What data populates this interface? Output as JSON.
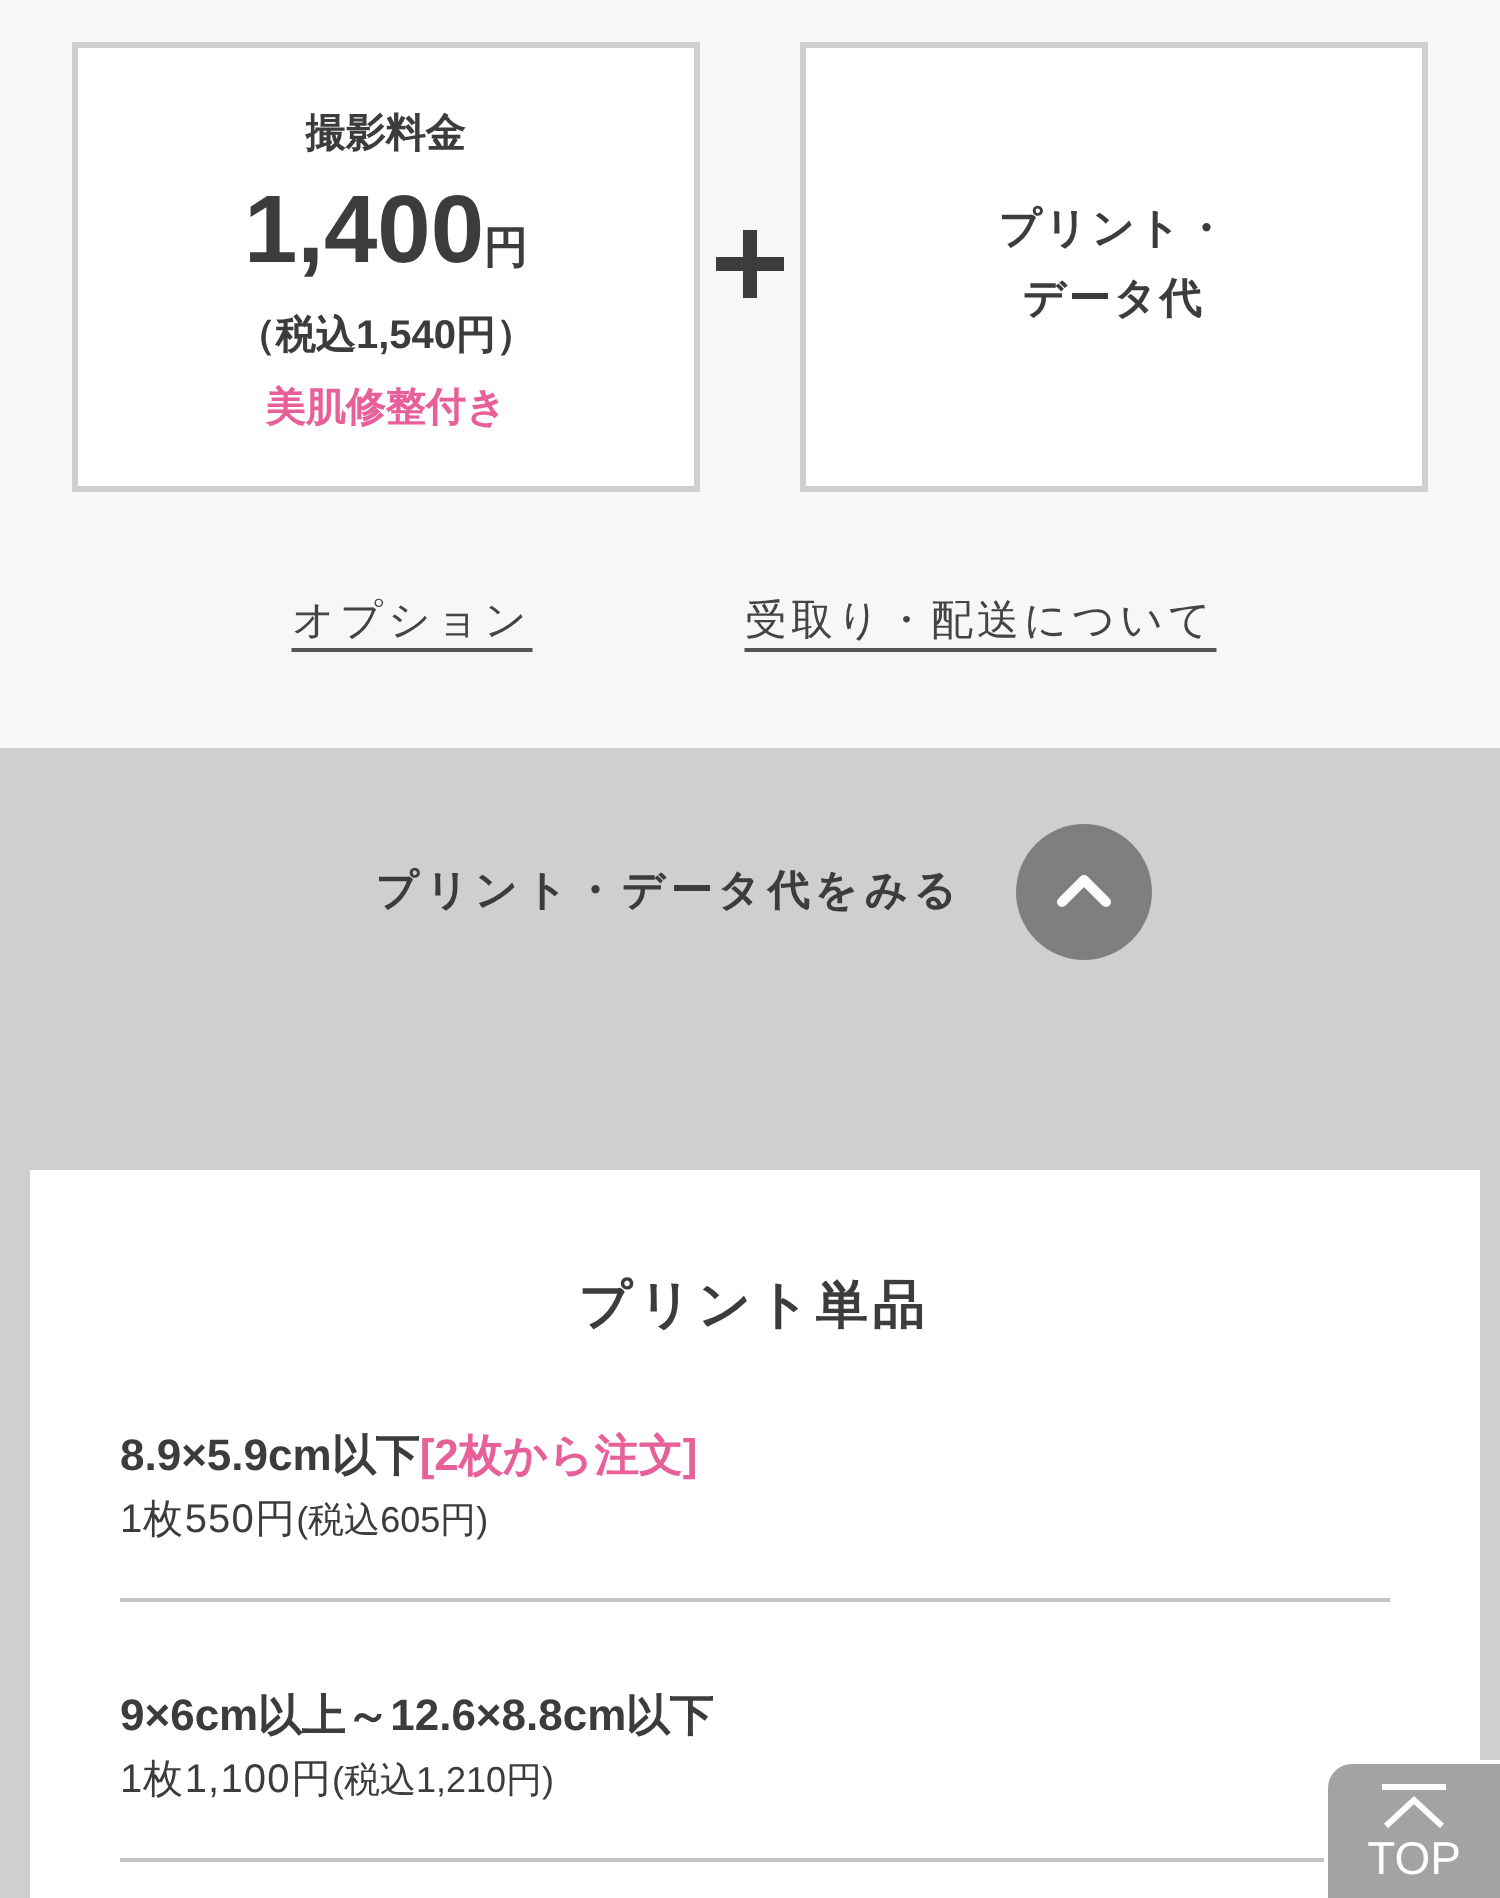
{
  "fee_cards": [
    {
      "kind": "shooting",
      "title": "撮影料金",
      "amount": "1,400",
      "unit": "円",
      "tax_note": "（税込1,540円）",
      "note": "美肌修整付き"
    },
    {
      "kind": "print",
      "title_lines": [
        "プリント・",
        "データ代"
      ]
    }
  ],
  "links": [
    "オプション",
    "受取り・配送について"
  ],
  "toggle": {
    "label": "プリント・データ代をみる",
    "expanded": true
  },
  "print_section": {
    "title": "プリント単品",
    "items": [
      {
        "size": "8.9×5.9cm以下",
        "note": "[2枚から注文]",
        "price": "1枚550円",
        "tax": "(税込605円)"
      },
      {
        "size": "9×6cm以上～12.6×8.8cm以下",
        "price": "1枚1,100円",
        "tax": "(税込1,210円)"
      }
    ]
  },
  "top_button": {
    "label": "TOP"
  }
}
